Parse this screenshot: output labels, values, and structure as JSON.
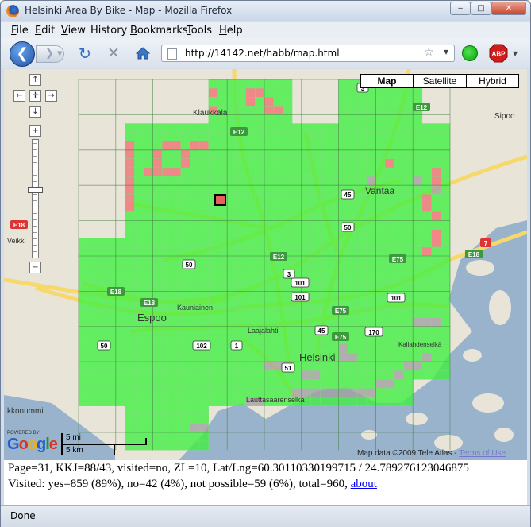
{
  "window": {
    "title": "Helsinki Area By Bike - Map - Mozilla Firefox",
    "minimize": "‒",
    "maximize": "□",
    "close": "✕"
  },
  "menubar": {
    "items": [
      {
        "key": "F",
        "rest": "ile"
      },
      {
        "key": "E",
        "rest": "dit"
      },
      {
        "key": "V",
        "rest": "iew"
      },
      {
        "key": "",
        "rest": "History",
        "u": "s"
      },
      {
        "key": "B",
        "rest": "ookmarks"
      },
      {
        "key": "T",
        "rest": "ools"
      },
      {
        "key": "H",
        "rest": "elp"
      }
    ]
  },
  "navbar": {
    "url": "http://14142.net/habb/map.html",
    "abp": "ABP"
  },
  "map": {
    "types": [
      "Map",
      "Satellite",
      "Hybrid"
    ],
    "selected_type": "Map",
    "place_labels": [
      {
        "text": "Klaukkala"
      },
      {
        "text": "Sipoo"
      },
      {
        "text": "Vantaa"
      },
      {
        "text": "Espoo"
      },
      {
        "text": "Kauniainen"
      },
      {
        "text": "Laajalahti"
      },
      {
        "text": "Helsinki"
      },
      {
        "text": "Kallahdenselkä"
      },
      {
        "text": "Lauttasaarenselkä"
      },
      {
        "text": "Veikk"
      },
      {
        "text": "kkonummi"
      }
    ],
    "road_shields": [
      "E12",
      "E12",
      "45",
      "50",
      "E18",
      "E75",
      "101",
      "E12",
      "E75",
      "170",
      "101",
      "102",
      "45",
      "E18",
      "50",
      "1",
      "51",
      "3",
      "E18",
      "7",
      "E18",
      "50",
      "E75",
      "101",
      "3"
    ],
    "credit": "Map data ©2009 Tele Atlas - ",
    "terms_link": "Terms of Use",
    "powered_by": "POWERED BY",
    "google": "Google",
    "scale_mi": "5 mi",
    "scale_km": "5 km",
    "zoom_plus": "+",
    "zoom_minus": "−"
  },
  "info": {
    "line1": "Page=31, KKJ=88/43, visited=no, ZL=10, Lat/Lng=60.30110330199715 / 24.789276123046875",
    "line2": "Visited: yes=859 (89%), no=42 (4%), not possible=59 (6%), total=960, ",
    "about_link": "about"
  },
  "status": {
    "text": "Done"
  },
  "colors": {
    "visited": "#3ef03e",
    "not_visited": "#f07070",
    "not_possible": "#a0a0a0",
    "water": "#99b3cc",
    "land": "#e8e4d8"
  }
}
